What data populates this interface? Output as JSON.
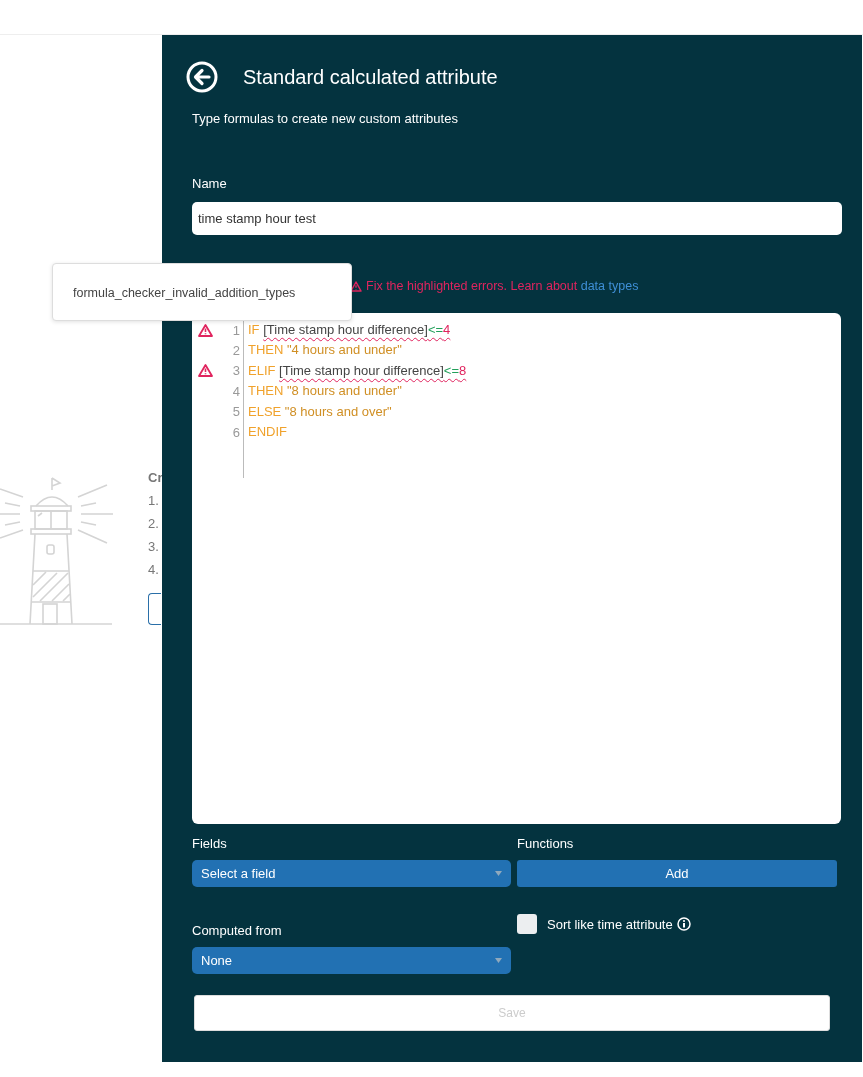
{
  "background": {
    "heading": "Cr",
    "steps": [
      "1.",
      "2.",
      "3.",
      "4."
    ]
  },
  "panel": {
    "title": "Standard calculated attribute",
    "subtitle": "Type formulas to create new custom attributes",
    "name": {
      "label": "Name",
      "value": "time stamp hour test"
    },
    "error": {
      "text": "Fix the highlighted errors. Learn about",
      "link": "data types"
    },
    "tooltip": "formula_checker_invalid_addition_types",
    "editor": {
      "lines": [
        {
          "number": "1",
          "error": true,
          "tokens": [
            {
              "kind": "keyword",
              "text": "IF "
            },
            {
              "kind": "field",
              "text": "[Time stamp hour difference]",
              "flagged": true
            },
            {
              "kind": "operator",
              "text": "<="
            },
            {
              "kind": "number",
              "text": "4"
            }
          ]
        },
        {
          "number": "2",
          "error": false,
          "tokens": [
            {
              "kind": "keyword",
              "text": "THEN "
            },
            {
              "kind": "string",
              "text": "\"4 hours and under\"",
              "flagged": false
            }
          ]
        },
        {
          "number": "3",
          "error": true,
          "tokens": [
            {
              "kind": "keyword",
              "text": "ELIF "
            },
            {
              "kind": "field",
              "text": "[Time stamp hour difference]",
              "flagged": true
            },
            {
              "kind": "operator",
              "text": "<="
            },
            {
              "kind": "number",
              "text": "8"
            }
          ]
        },
        {
          "number": "4",
          "error": false,
          "tokens": [
            {
              "kind": "keyword",
              "text": "THEN "
            },
            {
              "kind": "string",
              "text": "\"8 hours and under\"",
              "flagged": false
            }
          ]
        },
        {
          "number": "5",
          "error": false,
          "tokens": [
            {
              "kind": "keyword",
              "text": "ELSE "
            },
            {
              "kind": "string",
              "text": "\"8 hours and over\"",
              "flagged": false
            }
          ]
        },
        {
          "number": "6",
          "error": false,
          "tokens": [
            {
              "kind": "keyword",
              "text": "ENDIF"
            }
          ]
        }
      ]
    },
    "fields": {
      "label": "Fields",
      "value": "Select a field"
    },
    "functions": {
      "label": "Functions",
      "button": "Add"
    },
    "computed_from": {
      "label": "Computed from",
      "value": "None"
    },
    "sort_like_time": {
      "label": "Sort like time attribute",
      "checked": false
    },
    "save": {
      "label": "Save",
      "disabled": true
    }
  }
}
